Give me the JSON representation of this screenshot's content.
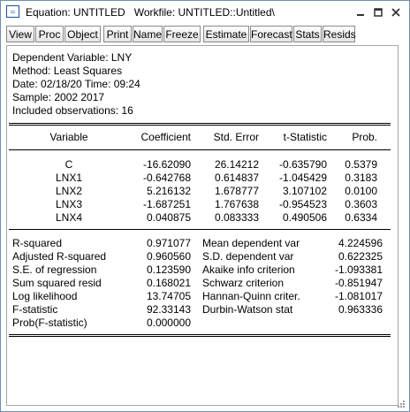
{
  "window": {
    "title": "Equation: UNTITLED   Workfile: UNTITLED::Untitled\\",
    "controls": [
      "minimize-icon",
      "maximize-icon",
      "close-icon"
    ]
  },
  "toolbar": {
    "buttons": [
      "View",
      "Proc",
      "Object",
      "Print",
      "Name",
      "Freeze",
      "Estimate",
      "Forecast",
      "Stats",
      "Resids"
    ]
  },
  "header": {
    "dependent": "Dependent Variable: LNY",
    "method": "Method: Least Squares",
    "date": "Date: 02/18/20   Time: 09:24",
    "sample": "Sample: 2002 2017",
    "obs": "Included observations: 16"
  },
  "coef_table": {
    "columns": [
      "Variable",
      "Coefficient",
      "Std. Error",
      "t-Statistic",
      "Prob."
    ],
    "rows": [
      [
        "C",
        "-16.62090",
        "26.14212",
        "-0.635790",
        "0.5379"
      ],
      [
        "LNX1",
        "-0.642768",
        "0.614837",
        "-1.045429",
        "0.3183"
      ],
      [
        "LNX2",
        "5.216132",
        "1.678777",
        "3.107102",
        "0.0100"
      ],
      [
        "LNX3",
        "-1.687251",
        "1.767638",
        "-0.954523",
        "0.3603"
      ],
      [
        "LNX4",
        "0.040875",
        "0.083333",
        "0.490506",
        "0.6334"
      ]
    ]
  },
  "stats": {
    "left": [
      [
        "R-squared",
        "0.971077"
      ],
      [
        "Adjusted R-squared",
        "0.960560"
      ],
      [
        "S.E. of regression",
        "0.123590"
      ],
      [
        "Sum squared resid",
        "0.168021"
      ],
      [
        "Log likelihood",
        "13.74705"
      ],
      [
        "F-statistic",
        "92.33143"
      ],
      [
        "Prob(F-statistic)",
        "0.000000"
      ]
    ],
    "right": [
      [
        "Mean dependent var",
        "4.224596"
      ],
      [
        "S.D. dependent var",
        "0.622325"
      ],
      [
        "Akaike info criterion",
        "-1.093381"
      ],
      [
        "Schwarz criterion",
        "-0.851947"
      ],
      [
        "Hannan-Quinn criter.",
        "-1.081017"
      ],
      [
        "Durbin-Watson stat",
        "0.963336"
      ]
    ]
  }
}
